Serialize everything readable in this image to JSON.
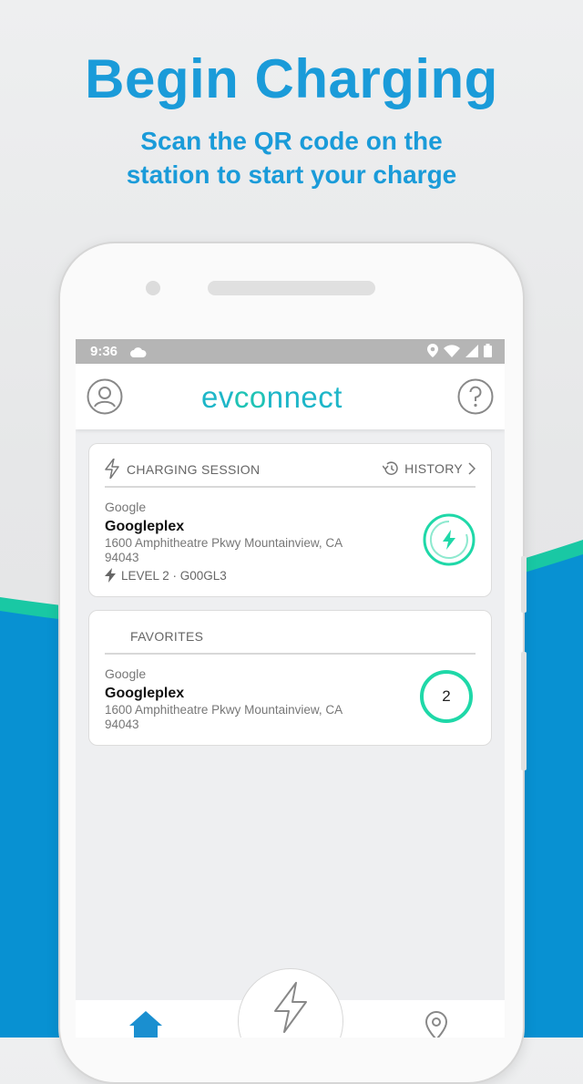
{
  "promo": {
    "headline": "Begin Charging",
    "subline_1": "Scan the QR code on the",
    "subline_2": "station to start your charge"
  },
  "status_bar": {
    "time": "9:36"
  },
  "app_bar": {
    "logo_left": "ev",
    "logo_mid": "co",
    "logo_right": "nnect"
  },
  "charging_session": {
    "title": "CHARGING SESSION",
    "history_label": "HISTORY",
    "brand": "Google",
    "name": "Googleplex",
    "address": "1600 Amphitheatre Pkwy Mountainview, CA 94043",
    "level": "LEVEL 2 · G00GL3"
  },
  "favorites": {
    "title": "FAVORITES",
    "brand": "Google",
    "name": "Googleplex",
    "address": "1600 Amphitheatre Pkwy Mountainview, CA 94043",
    "count": "2"
  },
  "colors": {
    "brand_blue": "#1a9bd9",
    "accent_green": "#1fd8a8",
    "wave_blue": "#0891d2"
  },
  "icons": [
    "user-icon",
    "help-icon",
    "bolt-icon",
    "history-icon",
    "chevron-right-icon",
    "charging-icon",
    "home-icon",
    "location-icon",
    "cloud-icon",
    "wifi-icon",
    "signal-icon",
    "battery-icon"
  ]
}
